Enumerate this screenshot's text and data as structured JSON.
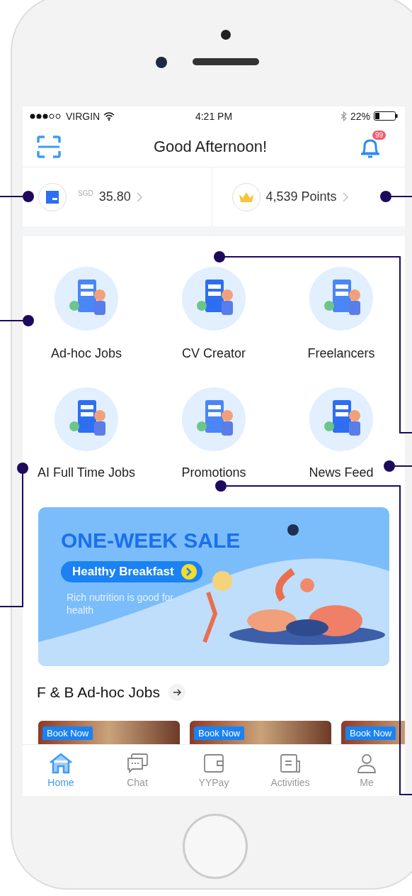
{
  "status_bar": {
    "carrier": "VIRGIN",
    "time": "4:21 PM",
    "battery": "22%"
  },
  "header": {
    "title": "Good Afternoon!",
    "notification_badge": "99"
  },
  "wallet": {
    "currency": "SGD",
    "amount": "35.80"
  },
  "points": {
    "text": "4,539 Points"
  },
  "features": [
    {
      "label": "Ad-hoc Jobs"
    },
    {
      "label": "CV Creator"
    },
    {
      "label": "Freelancers"
    },
    {
      "label": "AI Full Time Jobs"
    },
    {
      "label": "Promotions"
    },
    {
      "label": "News Feed"
    }
  ],
  "banner": {
    "title": "ONE-WEEK SALE",
    "button": "Healthy Breakfast",
    "subtitle": "Rich nutrition is good for health"
  },
  "section": {
    "title": "F & B Ad-hoc Jobs"
  },
  "job_cards": [
    {
      "badge": "Book Now"
    },
    {
      "badge": "Book Now"
    },
    {
      "badge": "Book Now"
    }
  ],
  "bottom_nav": [
    {
      "label": "Home",
      "kind": "home",
      "selected": true
    },
    {
      "label": "Chat",
      "kind": "chat",
      "selected": false
    },
    {
      "label": "YYPay",
      "kind": "wallet",
      "selected": false
    },
    {
      "label": "Activities",
      "kind": "activities",
      "selected": false
    },
    {
      "label": "Me",
      "kind": "profile",
      "selected": false
    }
  ]
}
